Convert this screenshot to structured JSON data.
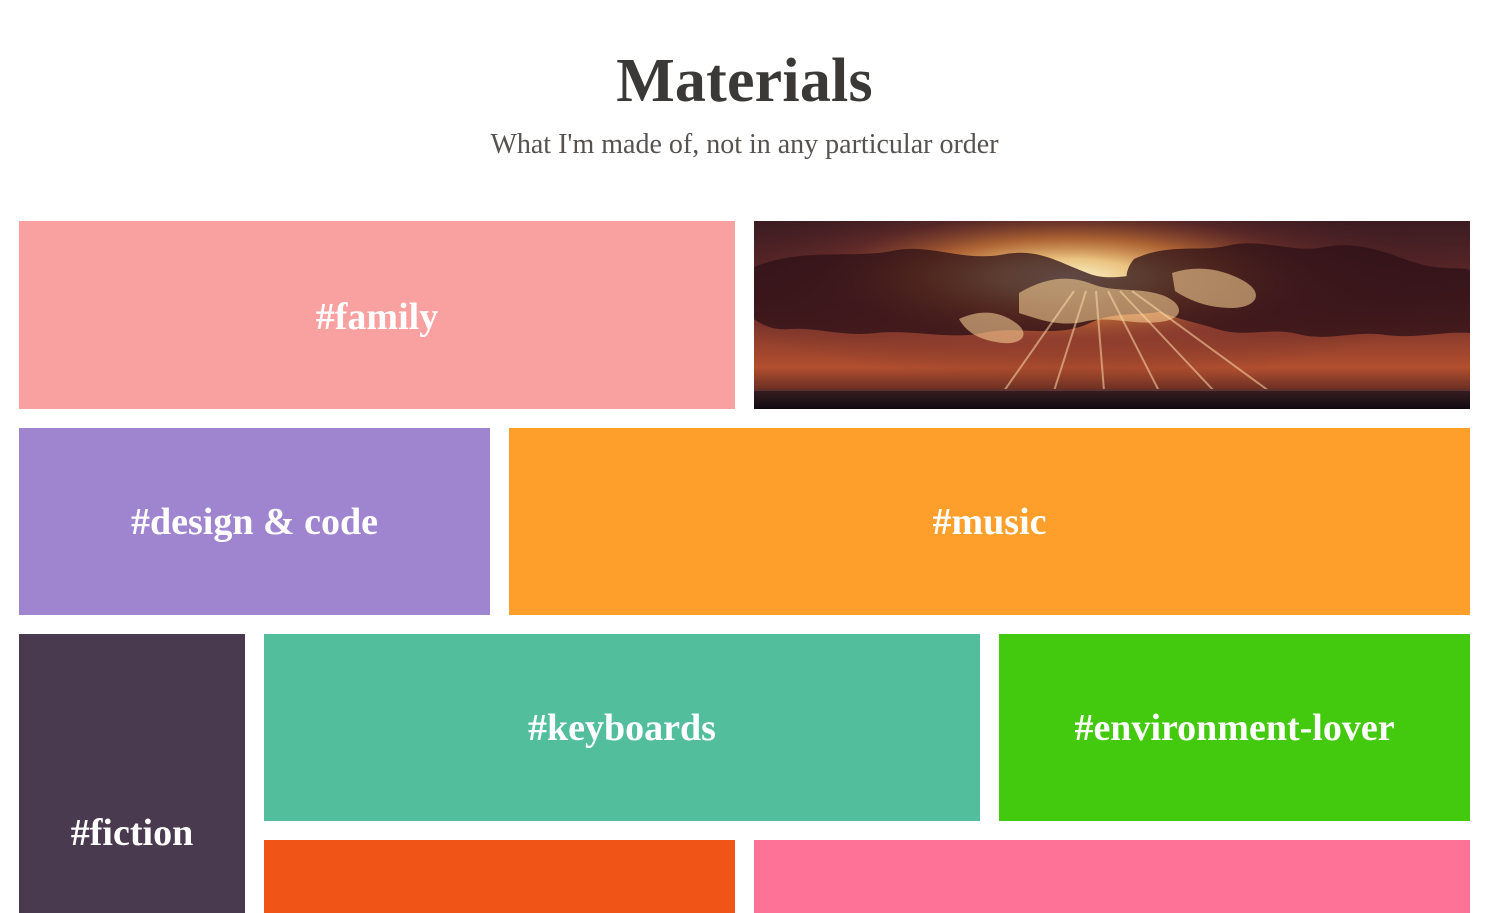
{
  "header": {
    "title": "Materials",
    "subtitle": "What I'm made of, not in any particular order"
  },
  "tiles": [
    {
      "label": "#family",
      "color": "#f9a0a0"
    },
    {
      "label": "",
      "color": "#3a1b20",
      "image": "sunset-clouds-photo"
    },
    {
      "label": "#design & code",
      "color": "#9f85cf"
    },
    {
      "label": "#music",
      "color": "#ff9f2b"
    },
    {
      "label": "#fiction",
      "color": "#4a3a4f"
    },
    {
      "label": "#keyboards",
      "color": "#53be9c"
    },
    {
      "label": "#environment-lover",
      "color": "#43c90d"
    },
    {
      "label": "",
      "color": "#f05417"
    },
    {
      "label": "",
      "color": "#ff7297"
    }
  ]
}
